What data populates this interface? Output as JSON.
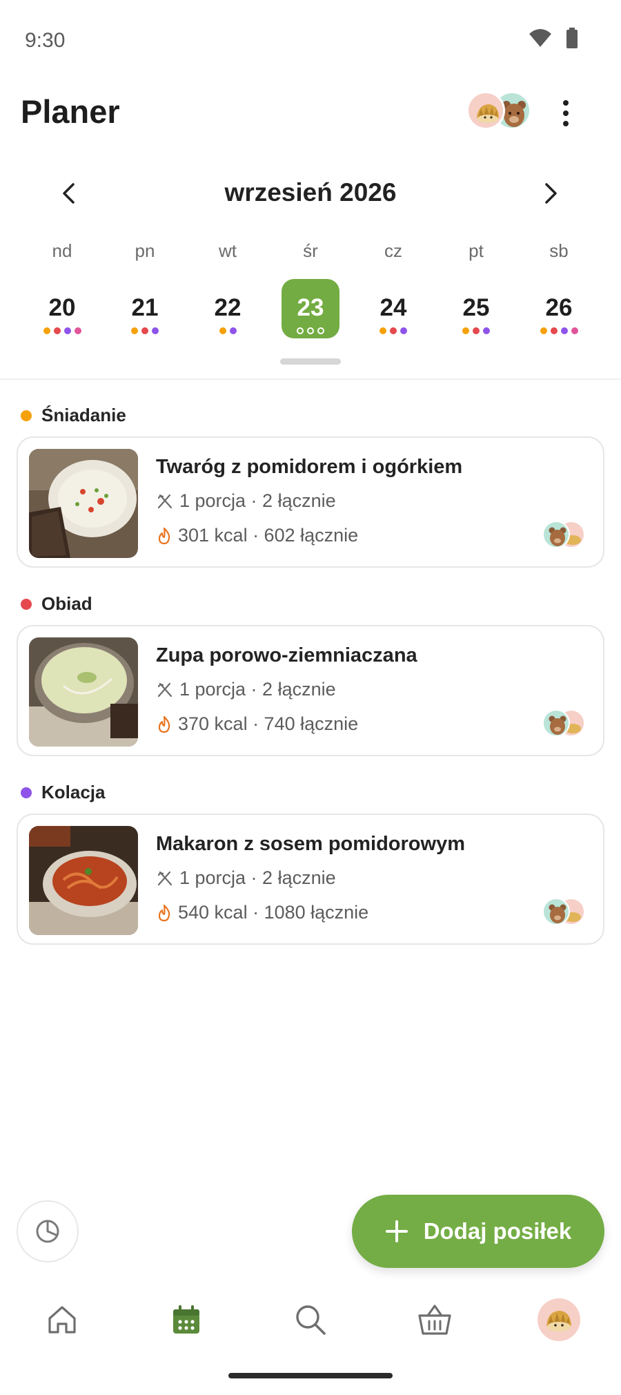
{
  "status_bar": {
    "time": "9:30"
  },
  "header": {
    "title": "Planer"
  },
  "calendar": {
    "month_label": "wrzesień 2026",
    "weekdays": [
      "nd",
      "pn",
      "wt",
      "śr",
      "cz",
      "pt",
      "sb"
    ],
    "days": [
      {
        "num": "20",
        "dots": [
          "#f5a10c",
          "#e5484d",
          "#8e54e9",
          "#e0559a"
        ]
      },
      {
        "num": "21",
        "dots": [
          "#f5a10c",
          "#e5484d",
          "#8e54e9"
        ]
      },
      {
        "num": "22",
        "dots": [
          "#f5a10c",
          "#8e54e9"
        ]
      },
      {
        "num": "23",
        "dots": [
          "#ffffff",
          "#ffffff",
          "#ffffff"
        ],
        "selected": true
      },
      {
        "num": "24",
        "dots": [
          "#f5a10c",
          "#e5484d",
          "#8e54e9"
        ]
      },
      {
        "num": "25",
        "dots": [
          "#f5a10c",
          "#e5484d",
          "#8e54e9"
        ]
      },
      {
        "num": "26",
        "dots": [
          "#f5a10c",
          "#e5484d",
          "#8e54e9",
          "#e0559a"
        ]
      }
    ]
  },
  "meals": [
    {
      "section": "Śniadanie",
      "section_color": "#f5a10c",
      "name": "Twaróg z pomidorem i ogórkiem",
      "portions": "1 porcja · 2 łącznie",
      "kcal": "301 kcal · 602 łącznie"
    },
    {
      "section": "Obiad",
      "section_color": "#e5484d",
      "name": "Zupa porowo-ziemniaczana",
      "portions": "1 porcja · 2 łącznie",
      "kcal": "370 kcal · 740 łącznie"
    },
    {
      "section": "Kolacja",
      "section_color": "#8e54e9",
      "name": "Makaron z sosem pomidorowym",
      "portions": "1 porcja · 2 łącznie",
      "kcal": "540 kcal · 1080 łącznie"
    }
  ],
  "fab": {
    "label": "Dodaj posiłek"
  },
  "colors": {
    "accent": "#74ad45",
    "flame": "#e9731d"
  },
  "bottom_nav": [
    "home-icon",
    "calendar-icon",
    "search-icon",
    "basket-icon",
    "profile-avatar"
  ]
}
